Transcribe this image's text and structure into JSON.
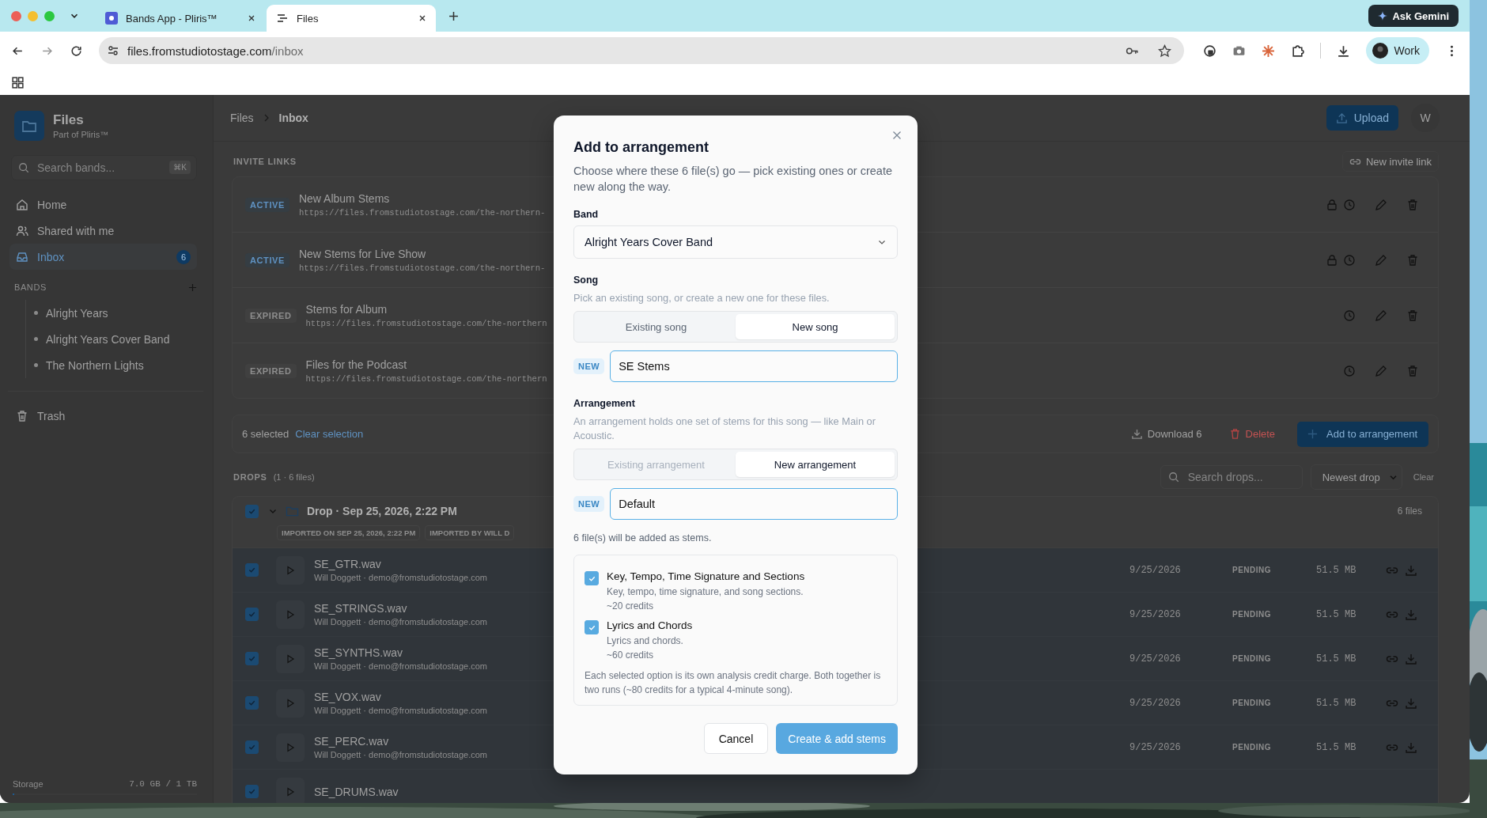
{
  "browser": {
    "tabs": [
      {
        "title": "Bands App - Pliris™",
        "selected": false
      },
      {
        "title": "Files",
        "selected": true
      }
    ],
    "gemini": "Ask Gemini",
    "url_host": "files.fromstudiotostage.com",
    "url_path": "/inbox",
    "profile": "Work"
  },
  "sidebar": {
    "app_name": "Files",
    "app_subtitle": "Part of Pliris™",
    "search": {
      "placeholder": "Search bands...",
      "shortcut": "⌘K"
    },
    "nav": [
      {
        "label": "Home",
        "kind": "home",
        "selected": false
      },
      {
        "label": "Shared with me",
        "kind": "shared",
        "selected": false
      },
      {
        "label": "Inbox",
        "kind": "inbox",
        "selected": true,
        "badge": "6"
      }
    ],
    "bands_heading": "BANDS",
    "bands": [
      "Alright Years",
      "Alright Years Cover Band",
      "The Northern Lights"
    ],
    "trash": "Trash",
    "storage": {
      "label": "Storage",
      "value": "7.0 GB / 1 TB",
      "level": 0.007
    }
  },
  "header": {
    "breadcrumb": [
      "Files",
      "Inbox"
    ],
    "upload": "Upload",
    "avatar": "W"
  },
  "invite_links": {
    "heading": "INVITE LINKS",
    "new_button": "New invite link",
    "items": [
      {
        "title": "New Album Stems",
        "url": "https://files.fromstudiotostage.com/the-northern-",
        "status": "ACTIVE",
        "active": true,
        "locked": true
      },
      {
        "title": "New Stems for Live Show",
        "url": "https://files.fromstudiotostage.com/the-northern-",
        "status": "ACTIVE",
        "active": true,
        "locked": true
      },
      {
        "title": "Stems for Album",
        "url": "https://files.fromstudiotostage.com/the-northern",
        "status": "EXPIRED",
        "active": false,
        "locked": false
      },
      {
        "title": "Files for the Podcast",
        "url": "https://files.fromstudiotostage.com/the-northern",
        "status": "EXPIRED",
        "active": false,
        "locked": false
      }
    ]
  },
  "selection": {
    "count": "6 selected",
    "clear": "Clear selection",
    "download": "Download 6",
    "delete": "Delete",
    "add": "Add to arrangement"
  },
  "drops": {
    "heading": "DROPS",
    "count": "(1 · 6 files)",
    "search_placeholder": "Search drops...",
    "sort": "Newest drop",
    "clear": "Clear",
    "groups": [
      {
        "title": "Drop · Sep 25, 2026, 2:22 PM",
        "checked": true,
        "expanded": true,
        "file_count": "6 files",
        "tags": [
          "IMPORTED ON SEP 25, 2026, 2:22 PM",
          "IMPORTED BY WILL D"
        ],
        "files": [
          {
            "name": "SE_GTR.wav",
            "owner": "Will Doggett · demo@fromstudiotostage.com",
            "date": "9/25/2026",
            "status": "PENDING",
            "size": "51.5 MB",
            "checked": true
          },
          {
            "name": "SE_STRINGS.wav",
            "owner": "Will Doggett · demo@fromstudiotostage.com",
            "date": "9/25/2026",
            "status": "PENDING",
            "size": "51.5 MB",
            "checked": true
          },
          {
            "name": "SE_SYNTHS.wav",
            "owner": "Will Doggett · demo@fromstudiotostage.com",
            "date": "9/25/2026",
            "status": "PENDING",
            "size": "51.5 MB",
            "checked": true
          },
          {
            "name": "SE_VOX.wav",
            "owner": "Will Doggett · demo@fromstudiotostage.com",
            "date": "9/25/2026",
            "status": "PENDING",
            "size": "51.5 MB",
            "checked": true
          },
          {
            "name": "SE_PERC.wav",
            "owner": "Will Doggett · demo@fromstudiotostage.com",
            "date": "9/25/2026",
            "status": "PENDING",
            "size": "51.5 MB",
            "checked": true
          },
          {
            "name": "SE_DRUMS.wav",
            "checked": true
          }
        ]
      }
    ]
  },
  "dialog": {
    "title": "Add to arrangement",
    "description": "Choose where these 6 file(s) go — pick existing ones or create new along the way.",
    "band": {
      "label": "Band",
      "value": "Alright Years Cover Band"
    },
    "song": {
      "label": "Song",
      "hint": "Pick an existing song, or create a new one for these files.",
      "modes": [
        {
          "label": "Existing song",
          "selected": false,
          "disabled": false
        },
        {
          "label": "New song",
          "selected": true,
          "disabled": false
        }
      ],
      "badge": "NEW",
      "value": "SE Stems"
    },
    "arrangement": {
      "label": "Arrangement",
      "hint": "An arrangement holds one set of stems for this song — like Main or Acoustic.",
      "modes": [
        {
          "label": "Existing arrangement",
          "selected": false,
          "disabled": true
        },
        {
          "label": "New arrangement",
          "selected": true,
          "disabled": false
        }
      ],
      "badge": "NEW",
      "value": "Default"
    },
    "summary": "6 file(s) will be added as stems.",
    "options": [
      {
        "title": "Key, Tempo, Time Signature and Sections",
        "description": "Key, tempo, time signature, and song sections.",
        "credits": "~20 credits",
        "checked": true
      },
      {
        "title": "Lyrics and Chords",
        "description": "Lyrics and chords.",
        "credits": "~60 credits",
        "checked": true
      }
    ],
    "note": "Each selected option is its own analysis credit charge. Both together is two runs (~80 credits for a typical 4-minute song).",
    "cancel": "Cancel",
    "submit": "Create & add stems"
  }
}
